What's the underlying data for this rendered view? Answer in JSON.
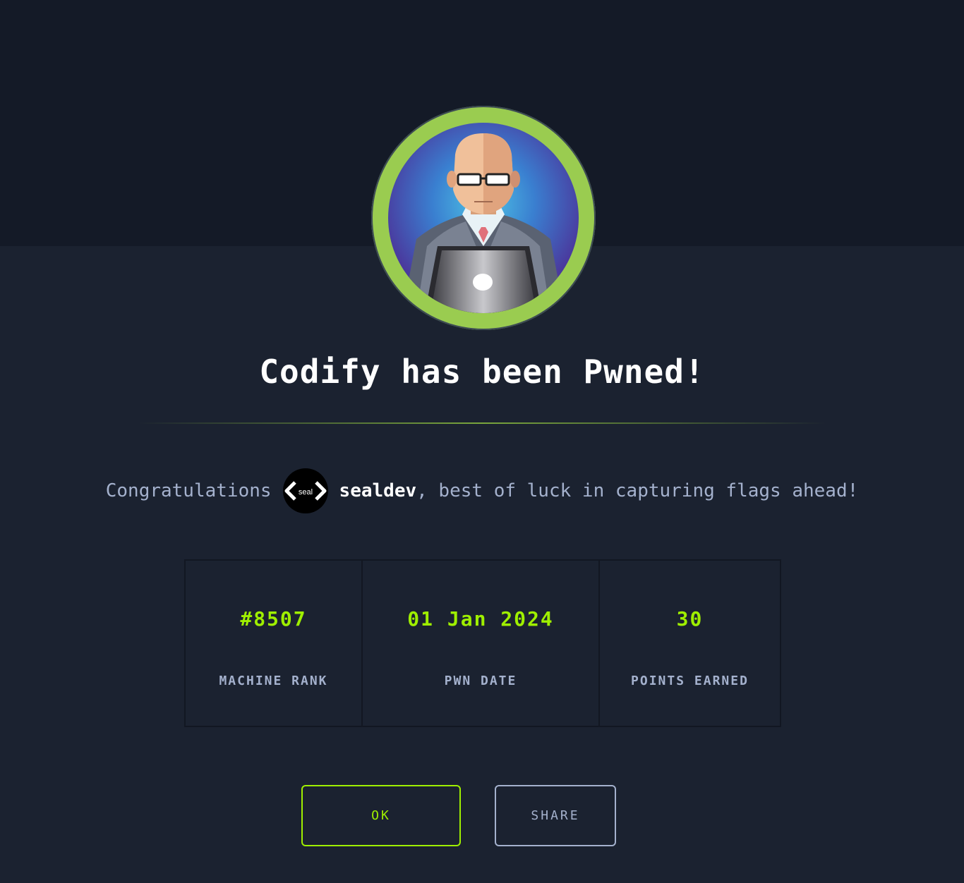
{
  "modal": {
    "title": "Codify has been Pwned!",
    "congrats_prefix": "Congratulations",
    "username": "sealdev",
    "congrats_suffix": ", best of luck in capturing flags ahead!",
    "user_avatar_text": "seal",
    "stats": [
      {
        "value": "#8507",
        "label": "MACHINE RANK"
      },
      {
        "value": "01 Jan 2024",
        "label": "PWN DATE"
      },
      {
        "value": "30",
        "label": "POINTS EARNED"
      }
    ],
    "buttons": {
      "ok": "OK",
      "share": "SHARE"
    }
  },
  "colors": {
    "background": "#1b2230",
    "top_band": "#141a27",
    "accent": "#9fef00",
    "ring": "#9acc50",
    "muted_text": "#a4b1cd"
  },
  "icons": {
    "machine_avatar": "bald-man-with-laptop-avatar",
    "user_avatar": "seal-code-brackets-logo"
  }
}
